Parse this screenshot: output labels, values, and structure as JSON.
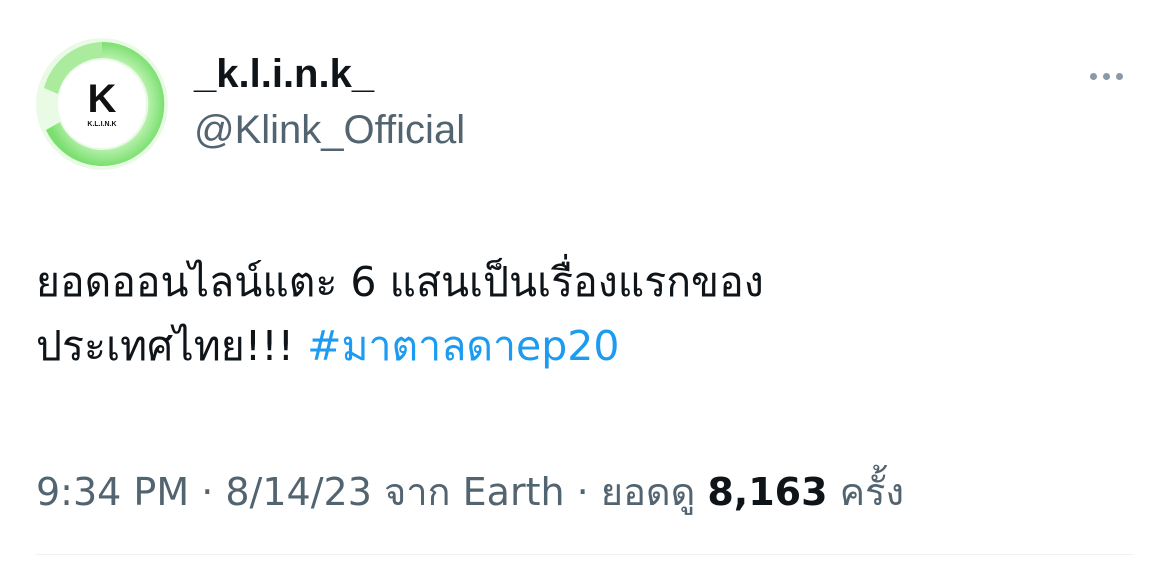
{
  "author": {
    "display_name": "_k.l.i.n.k_",
    "handle": "@Klink_Official",
    "avatar": {
      "letter": "K",
      "caption": "K.L.I.N.K",
      "ring_color": "#7be36f",
      "bg_color": "#ffffff"
    }
  },
  "more_icon": "more-horizontal-icon",
  "tweet": {
    "text_line1": "ยอดออนไลน์แตะ 6 แสนเป็นเรื่องแรกของ",
    "text_line2": "ประเทศไทย!!! ",
    "hashtag": "#มาตาลดาep20"
  },
  "meta": {
    "time": "9:34 PM",
    "sep1": " · ",
    "date": "8/14/23",
    "source": " จาก Earth",
    "sep2": " · ",
    "views_label": "ยอดดู ",
    "views_count": "8,163",
    "views_unit": " ครั้ง"
  },
  "colors": {
    "link": "#1d9bf0",
    "secondary": "#536471",
    "primary": "#0f1419",
    "divider": "#eff3f4"
  }
}
